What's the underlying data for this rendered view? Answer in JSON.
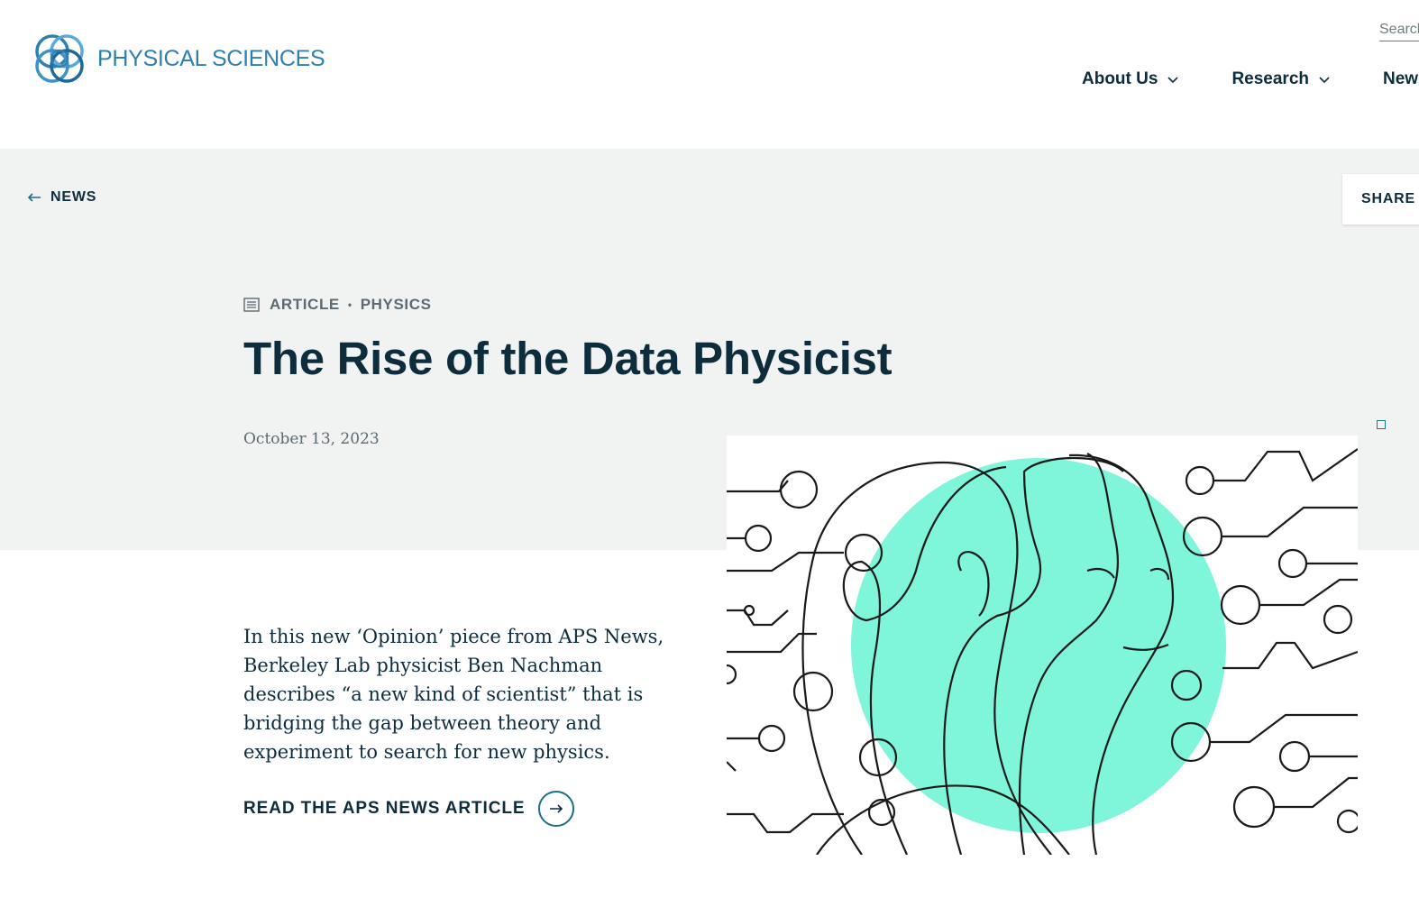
{
  "header": {
    "logo_text": "PHYSICAL SCIENCES",
    "search_placeholder": "Search",
    "nav": [
      {
        "label": "About Us"
      },
      {
        "label": "Research"
      },
      {
        "label": "News"
      }
    ]
  },
  "breadcrumb": {
    "back_label": "NEWS",
    "share_label": "SHARE"
  },
  "article": {
    "type_label": "ARTICLE",
    "separator": "•",
    "category_label": "PHYSICS",
    "title": "The Rise of the Data Physicist",
    "date": "October 13, 2023",
    "summary": "In this new ‘Opinion’ piece from APS News, Berkeley Lab physicist Ben Nachman describes “a new kind of scientist” that is bridging the gap between theory and experiment to search for new physics.",
    "cta_label": "READ THE APS NEWS ARTICLE"
  },
  "colors": {
    "brand_blue": "#2f7fb0",
    "text_navy": "#0e2d3c",
    "band_gray": "#f1f3f3",
    "accent_mint": "#7ff5da"
  }
}
